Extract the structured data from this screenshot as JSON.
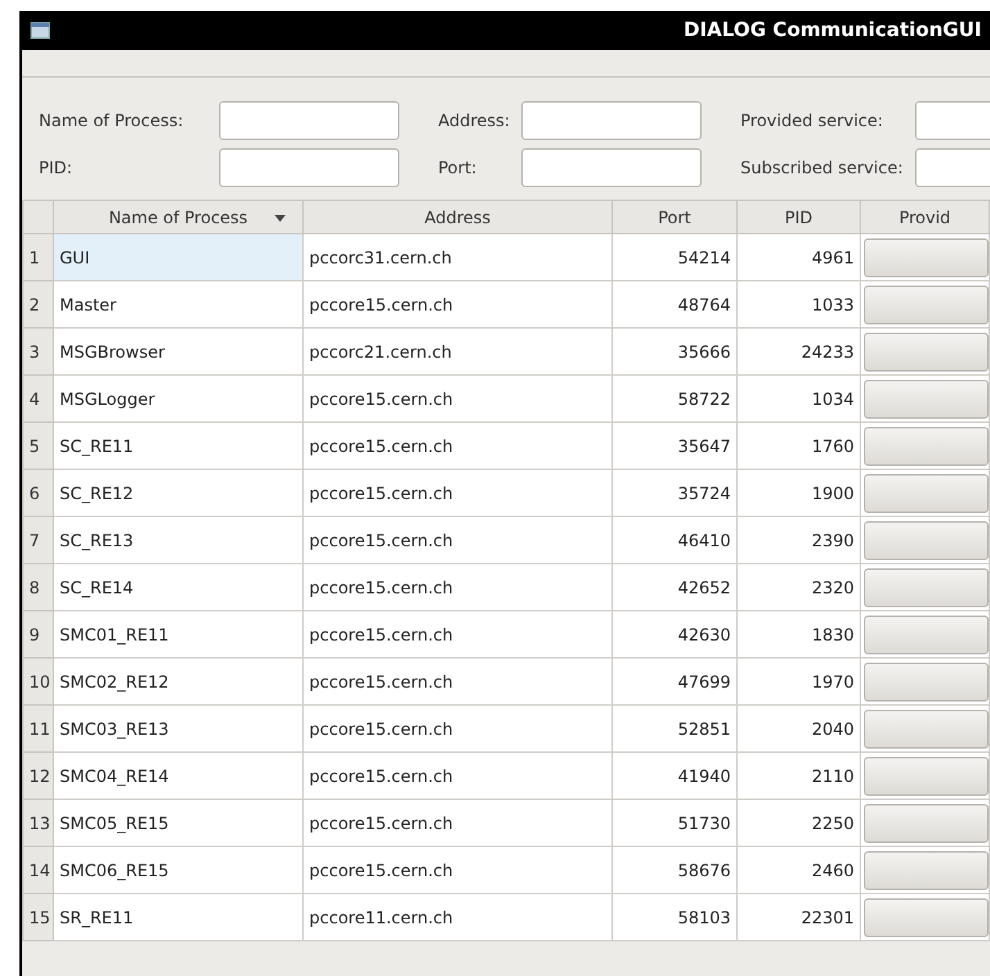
{
  "window": {
    "title": "DIALOG CommunicationGUI"
  },
  "filters": [
    {
      "label": "Name of Process:"
    },
    {
      "label": "Address:"
    },
    {
      "label": "Provided service:"
    },
    {
      "label": "PID:"
    },
    {
      "label": "Port:"
    },
    {
      "label": "Subscribed service:"
    }
  ],
  "table": {
    "columns": [
      {
        "label": "Name of Process",
        "sorted": true,
        "kind": "text"
      },
      {
        "label": "Address",
        "sorted": false,
        "kind": "text"
      },
      {
        "label": "Port",
        "sorted": false,
        "kind": "number"
      },
      {
        "label": "PID",
        "sorted": false,
        "kind": "number"
      },
      {
        "label": "Provid",
        "sorted": false,
        "kind": "button"
      }
    ],
    "rows": [
      {
        "number": "1",
        "cells": [
          "GUI",
          "pccorc31.cern.ch",
          "54214",
          "4961"
        ],
        "selected": true
      },
      {
        "number": "2",
        "cells": [
          "Master",
          "pccore15.cern.ch",
          "48764",
          "1033"
        ],
        "selected": false
      },
      {
        "number": "3",
        "cells": [
          "MSGBrowser",
          "pccorc21.cern.ch",
          "35666",
          "24233"
        ],
        "selected": false
      },
      {
        "number": "4",
        "cells": [
          "MSGLogger",
          "pccore15.cern.ch",
          "58722",
          "1034"
        ],
        "selected": false
      },
      {
        "number": "5",
        "cells": [
          "SC_RE11",
          "pccore15.cern.ch",
          "35647",
          "1760"
        ],
        "selected": false
      },
      {
        "number": "6",
        "cells": [
          "SC_RE12",
          "pccore15.cern.ch",
          "35724",
          "1900"
        ],
        "selected": false
      },
      {
        "number": "7",
        "cells": [
          "SC_RE13",
          "pccore15.cern.ch",
          "46410",
          "2390"
        ],
        "selected": false
      },
      {
        "number": "8",
        "cells": [
          "SC_RE14",
          "pccore15.cern.ch",
          "42652",
          "2320"
        ],
        "selected": false
      },
      {
        "number": "9",
        "cells": [
          "SMC01_RE11",
          "pccore15.cern.ch",
          "42630",
          "1830"
        ],
        "selected": false
      },
      {
        "number": "10",
        "cells": [
          "SMC02_RE12",
          "pccore15.cern.ch",
          "47699",
          "1970"
        ],
        "selected": false
      },
      {
        "number": "11",
        "cells": [
          "SMC03_RE13",
          "pccore15.cern.ch",
          "52851",
          "2040"
        ],
        "selected": false
      },
      {
        "number": "12",
        "cells": [
          "SMC04_RE14",
          "pccore15.cern.ch",
          "41940",
          "2110"
        ],
        "selected": false
      },
      {
        "number": "13",
        "cells": [
          "SMC05_RE15",
          "pccore15.cern.ch",
          "51730",
          "2250"
        ],
        "selected": false
      },
      {
        "number": "14",
        "cells": [
          "SMC06_RE15",
          "pccore15.cern.ch",
          "58676",
          "2460"
        ],
        "selected": false
      },
      {
        "number": "15",
        "cells": [
          "SR_RE11",
          "pccore11.cern.ch",
          "58103",
          "22301"
        ],
        "selected": false
      }
    ]
  }
}
